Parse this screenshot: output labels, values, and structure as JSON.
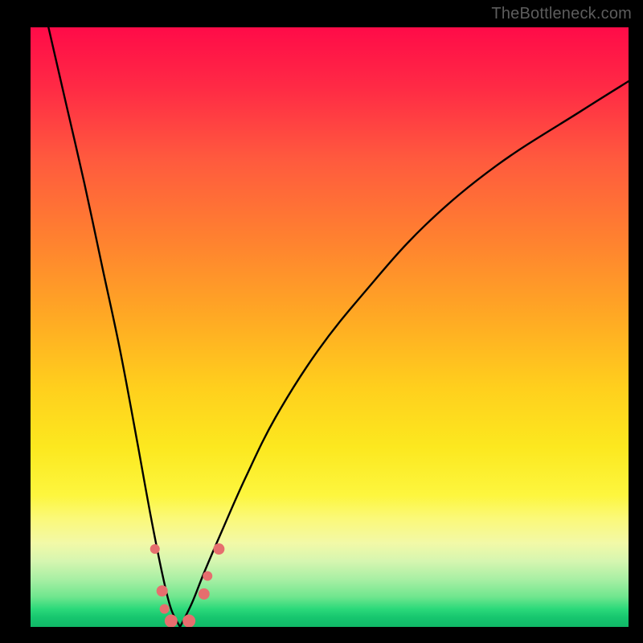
{
  "watermark": "TheBottleneck.com",
  "colors": {
    "bg": "#000000",
    "curve": "#000000",
    "marker_fill": "#e66e6e",
    "marker_stroke": "#c94f4f"
  },
  "chart_data": {
    "type": "line",
    "title": "",
    "xlabel": "",
    "ylabel": "",
    "x_range": [
      0,
      100
    ],
    "y_range": [
      0,
      100
    ],
    "description": "Bottleneck-style curve: two branches descending from upper-left and upper-right meeting at a V-shaped minimum near x≈25. Color gradient encodes bottleneck severity (red high → green low). A few marker points sit near the trough.",
    "series": [
      {
        "name": "left-branch",
        "x": [
          3,
          6,
          9,
          12,
          15,
          18,
          20,
          22,
          23.5,
          25
        ],
        "y": [
          100,
          87,
          74,
          60,
          46,
          30,
          19,
          9,
          3,
          0
        ]
      },
      {
        "name": "right-branch",
        "x": [
          25,
          27,
          29,
          32,
          36,
          41,
          48,
          56,
          66,
          78,
          92,
          100
        ],
        "y": [
          0,
          4,
          9,
          16,
          25,
          35,
          46,
          56,
          67,
          77,
          86,
          91
        ]
      }
    ],
    "markers": [
      {
        "x": 20.8,
        "y": 13,
        "r": 6
      },
      {
        "x": 22.0,
        "y": 6,
        "r": 7
      },
      {
        "x": 22.4,
        "y": 3,
        "r": 6
      },
      {
        "x": 23.5,
        "y": 1,
        "r": 8
      },
      {
        "x": 26.5,
        "y": 1,
        "r": 8
      },
      {
        "x": 29.0,
        "y": 5.5,
        "r": 7
      },
      {
        "x": 29.6,
        "y": 8.5,
        "r": 6
      },
      {
        "x": 31.5,
        "y": 13,
        "r": 7
      }
    ]
  }
}
